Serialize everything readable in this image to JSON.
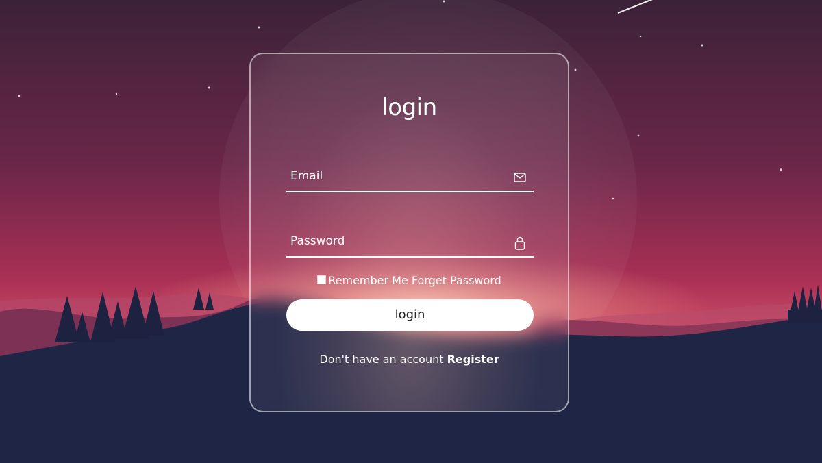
{
  "form": {
    "title": "login",
    "email_placeholder": "Email",
    "email_icon": "mail-icon",
    "password_placeholder": "Password",
    "password_icon": "lock-icon",
    "remember_label": "Remember Me",
    "forgot_label": "Forget Password",
    "submit_label": "login",
    "register_prompt": "Don't have an account",
    "register_link": "Register"
  },
  "colors": {
    "sky_top": "#3a2238",
    "sky_mid": "#8a2c56",
    "horizon": "#e0556f",
    "ground": "#1e2440",
    "card_border": "#ffffff"
  }
}
